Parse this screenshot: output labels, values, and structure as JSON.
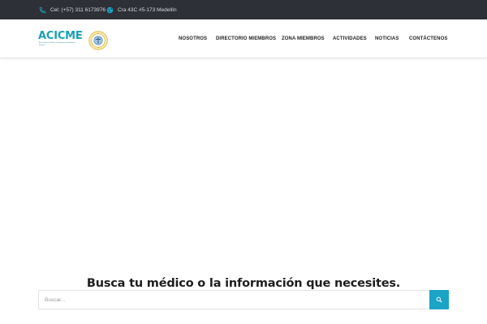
{
  "topbar": {
    "phone_text": "Cel: (+57) 311 6173976",
    "address_text": "Cra 43C #5-173 Medellín",
    "phone_icon": "phone-icon",
    "globe_icon": "globe-icon"
  },
  "header": {
    "logo_text": "ACICME",
    "logo_tm": "®",
    "logo_subtitle": "Asociación Científica Colombiana de Medicina Estética",
    "seal_icon": "seal-emblem"
  },
  "nav": {
    "items": [
      "NOSOTROS",
      "DIRECTORIO MIEMBROS",
      "ZONA MIEMBROS",
      "ACTIVIDADES",
      "NOTICIAS",
      "CONTÁCTENOS"
    ]
  },
  "search": {
    "title": "Busca tu médico o la información que necesites.",
    "placeholder": "Buscar...",
    "button_icon": "search-icon"
  },
  "colors": {
    "topbar_bg": "#2d3137",
    "accent": "#1ba4c6",
    "brand": "#1a9fb7"
  }
}
